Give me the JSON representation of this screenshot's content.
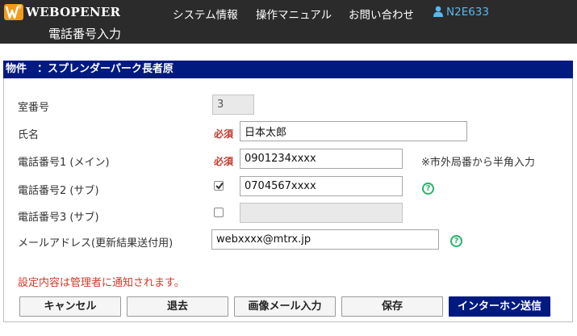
{
  "header": {
    "brand": "WEBOPENER",
    "nav": [
      "システム情報",
      "操作マニュアル",
      "お問い合わせ"
    ],
    "user": "N2E633",
    "page_title": "電話番号入力",
    "colors": {
      "bar": "#2b2b2b",
      "user": "#5bb8ef",
      "logo": "#f39a1e"
    }
  },
  "panel": {
    "title": "物件　：スプレンダーパーク長者原",
    "colors": {
      "header": "#001a80",
      "required": "#c0392b",
      "help": "#27b36b"
    }
  },
  "form": {
    "room": {
      "label": "室番号",
      "value": "3"
    },
    "name": {
      "label": "氏名",
      "required": "必須",
      "value": "日本太郎"
    },
    "phone1": {
      "label": "電話番号1 (メイン)",
      "required": "必須",
      "value": "0901234xxxx",
      "hint": "※市外局番から半角入力"
    },
    "phone2": {
      "label": "電話番号2 (サブ)",
      "checked": true,
      "value": "0704567xxxx",
      "help_icon": "?"
    },
    "phone3": {
      "label": "電話番号3 (サブ)",
      "checked": false,
      "value": ""
    },
    "email": {
      "label": "メールアドレス(更新結果送付用)",
      "value": "webxxxx@mtrx.jp",
      "help_icon": "?"
    }
  },
  "notice": "設定内容は管理者に通知されます。",
  "buttons": {
    "cancel": "キャンセル",
    "leave": "退去",
    "image_mail": "画像メール入力",
    "save": "保存",
    "intercom": "インターホン送信"
  }
}
